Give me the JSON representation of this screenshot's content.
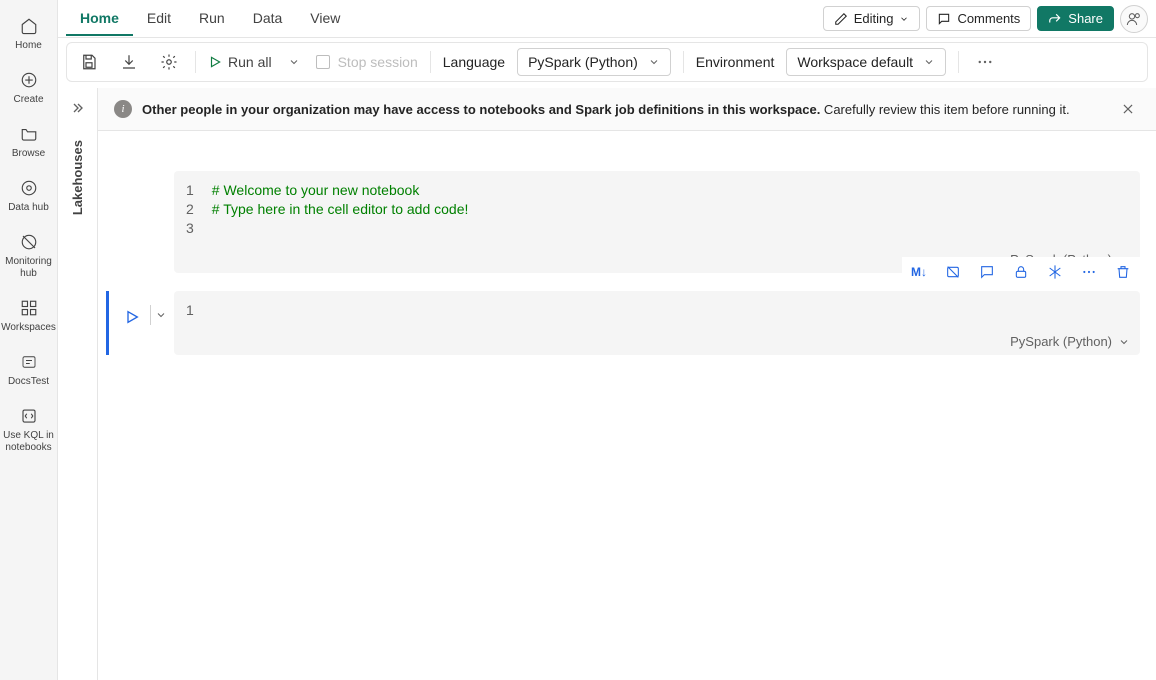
{
  "left_rail": {
    "items": [
      {
        "label": "Home"
      },
      {
        "label": "Create"
      },
      {
        "label": "Browse"
      },
      {
        "label": "Data hub"
      },
      {
        "label": "Monitoring hub"
      },
      {
        "label": "Workspaces"
      },
      {
        "label": "DocsTest"
      },
      {
        "label": "Use KQL in notebooks"
      }
    ]
  },
  "menu_tabs": [
    {
      "label": "Home",
      "active": true
    },
    {
      "label": "Edit"
    },
    {
      "label": "Run"
    },
    {
      "label": "Data"
    },
    {
      "label": "View"
    }
  ],
  "top_buttons": {
    "editing": "Editing",
    "comments": "Comments",
    "share": "Share"
  },
  "toolbar": {
    "run_all": "Run all",
    "stop_session": "Stop session",
    "language_label": "Language",
    "language_value": "PySpark (Python)",
    "environment_label": "Environment",
    "environment_value": "Workspace default"
  },
  "side_panel": {
    "vertical_label": "Lakehouses"
  },
  "info_bar": {
    "bold": "Other people in your organization may have access to notebooks and Spark job definitions in this workspace.",
    "rest": " Carefully review this item before running it."
  },
  "cells": [
    {
      "active": false,
      "show_gutter_actions": false,
      "show_toolbar": false,
      "lines": [
        {
          "n": "1",
          "text": "# Welcome to your new notebook",
          "class": "comment"
        },
        {
          "n": "2",
          "text": "# Type here in the cell editor to add code!",
          "class": "comment"
        },
        {
          "n": "3",
          "text": "",
          "class": ""
        }
      ],
      "lang": "PySpark (Python)"
    },
    {
      "active": true,
      "show_gutter_actions": true,
      "show_toolbar": true,
      "lines": [
        {
          "n": "1",
          "text": "",
          "class": ""
        }
      ],
      "lang": "PySpark (Python)"
    }
  ],
  "cell_toolbar_markdown": "M↓"
}
